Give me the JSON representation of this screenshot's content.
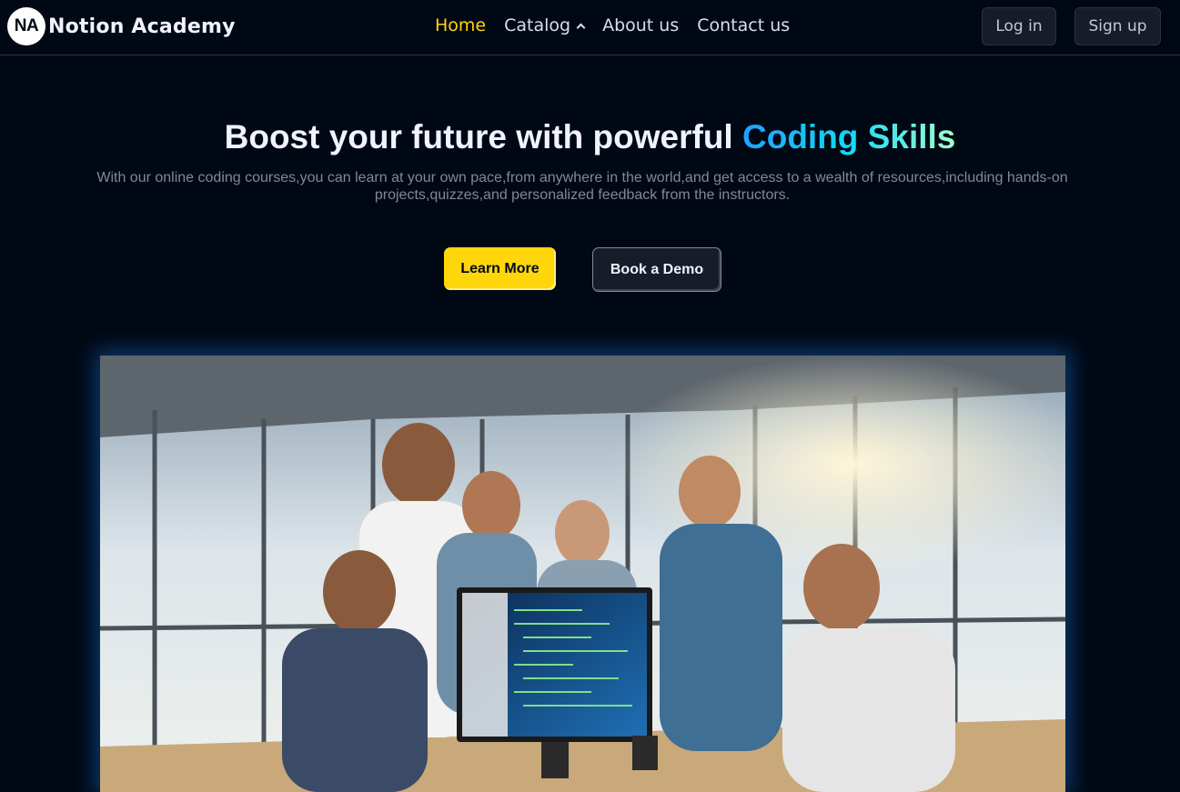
{
  "logo": {
    "badge": "NA",
    "name": "Notion Academy"
  },
  "nav": {
    "items": [
      {
        "label": "Home",
        "active": true
      },
      {
        "label": "Catalog",
        "has_dropdown": true
      },
      {
        "label": "About us"
      },
      {
        "label": "Contact us"
      }
    ]
  },
  "auth": {
    "login_label": "Log in",
    "signup_label": "Sign up"
  },
  "hero": {
    "title_prefix": "Boost your future with powerful ",
    "title_highlight": "Coding Skills",
    "subtitle": "With our online coding courses,you can learn at your own pace,from anywhere in the world,and get access to a wealth of resources,including hands-on projects,quizzes,and personalized feedback from the instructors.",
    "primary_cta": "Learn More",
    "secondary_cta": "Book a Demo",
    "image_icon": "team-coding-photo"
  },
  "colors": {
    "background": "#000814",
    "accent_yellow": "#FFD60A",
    "accent_gradient_start": "#1FA2FF",
    "accent_gradient_end": "#12D8FA",
    "text_muted": "#838894"
  }
}
